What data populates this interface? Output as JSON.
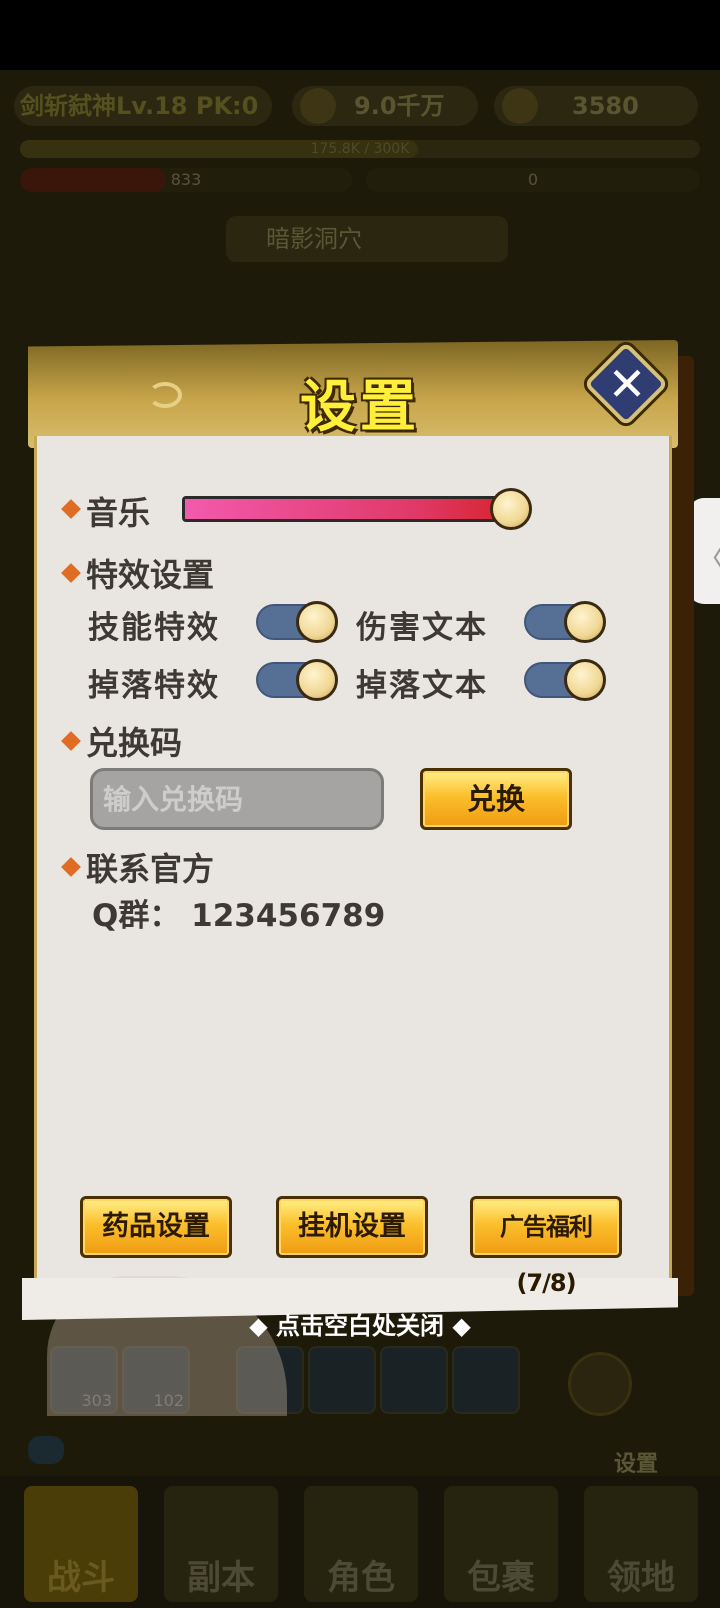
{
  "background": {
    "player_name": "剑斩弑神Lv.18 PK:0",
    "coins": "9.0千万",
    "gold": "3580",
    "exp_text": "175.8K / 300K",
    "exp_progress": 0.586,
    "hp_value": "833",
    "hp_progress": 0.44,
    "mp_value": "0",
    "map_name": "暗影洞穴",
    "side_tab_icon": "chevron-left-icon",
    "side_tab_glyph": "〈",
    "skills": [
      {
        "count": "303"
      },
      {
        "count": "102"
      }
    ],
    "settings_label": "设置",
    "nav": [
      {
        "label": "战斗",
        "active": true
      },
      {
        "label": "副本",
        "active": false
      },
      {
        "label": "角色",
        "active": false
      },
      {
        "label": "包裹",
        "active": false
      },
      {
        "label": "领地",
        "active": false
      }
    ]
  },
  "dialog": {
    "title": "设置",
    "close_glyph": "✕",
    "music": {
      "label": "音乐",
      "volume": 0.95
    },
    "effects": {
      "label": "特效设置",
      "options": [
        {
          "label": "技能特效",
          "on": true
        },
        {
          "label": "伤害文本",
          "on": true
        },
        {
          "label": "掉落特效",
          "on": true
        },
        {
          "label": "掉落文本",
          "on": true
        }
      ]
    },
    "redeem": {
      "label": "兑换码",
      "placeholder": "输入兑换码",
      "button": "兑换"
    },
    "contact": {
      "label": "联系官方",
      "qq_group": "Q群：  123456789"
    },
    "buttons": {
      "potion": "药品设置",
      "afk": "挂机设置",
      "ad_reward": "广告福利(7/8)"
    }
  },
  "hint": "◆ 点击空白处关闭 ◆",
  "colors": {
    "accent_orange": "#e06b22",
    "button_gold": "#fbbf2c",
    "title_yellow": "#ffef3a",
    "toggle_blue": "#566f95"
  }
}
